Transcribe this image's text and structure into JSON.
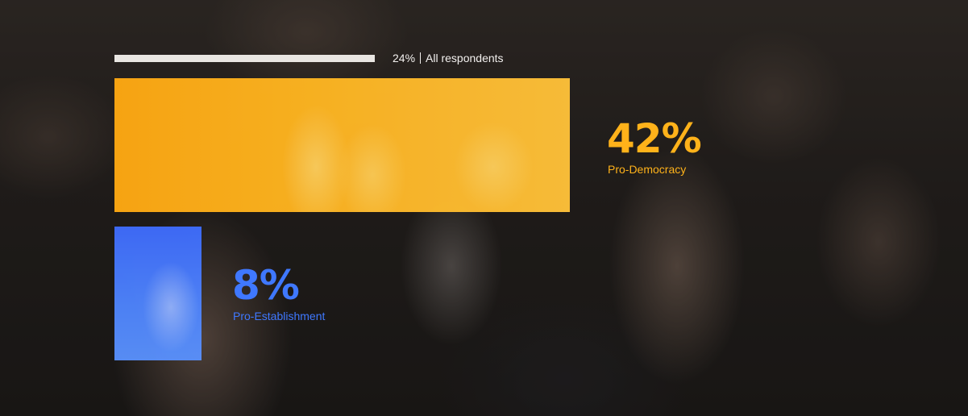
{
  "chart_data": {
    "type": "bar",
    "orientation": "area-bars",
    "total": {
      "value": 24,
      "value_label": "24%",
      "category": "All respondents"
    },
    "categories": [
      "Pro-Democracy",
      "Pro-Establishment"
    ],
    "values": [
      42,
      8
    ],
    "value_labels": [
      "42%",
      "8%"
    ],
    "colors": {
      "Pro-Democracy": "#ffb21a",
      "Pro-Establishment": "#3f78ff",
      "total_bar": "#e9e6e2",
      "text": "#f2f0ee"
    },
    "unit": "%"
  }
}
